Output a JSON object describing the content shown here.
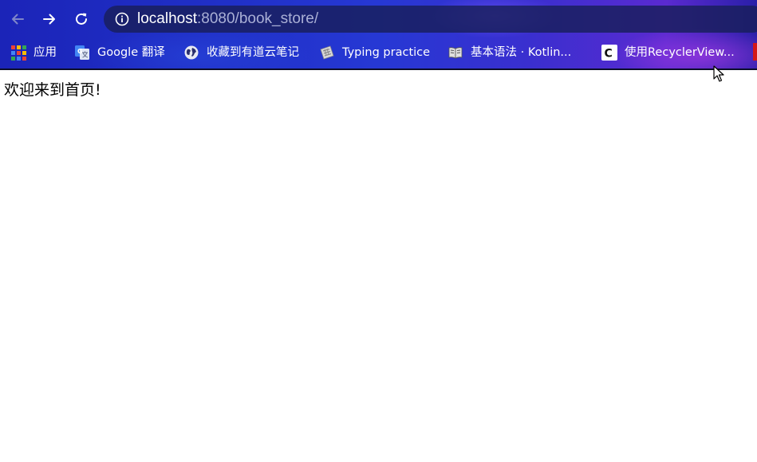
{
  "browser": {
    "address_bar": {
      "host": "localhost",
      "rest": ":8080/book_store/"
    },
    "bookmarks": [
      {
        "label": "应用",
        "icon": "apps-grid-icon"
      },
      {
        "label": "Google 翻译",
        "icon": "google-translate-icon"
      },
      {
        "label": "收藏到有道云笔记",
        "icon": "globe-icon"
      },
      {
        "label": "Typing practice",
        "icon": "keyboard-icon"
      },
      {
        "label": "基本语法 · Kotlin...",
        "icon": "book-icon"
      },
      {
        "label": "使用RecyclerView...",
        "icon": "csdn-c-icon"
      }
    ]
  },
  "page": {
    "welcome_text": "欢迎来到首页!"
  },
  "colors": {
    "toolbar_gradient_start": "#1b24b8",
    "toolbar_gradient_end": "#5a2ad0",
    "omnibox_bg": "#181e5a",
    "url_host": "#ffffff",
    "url_rest": "#aab0d6",
    "page_bg": "#ffffff",
    "text": "#000000"
  }
}
